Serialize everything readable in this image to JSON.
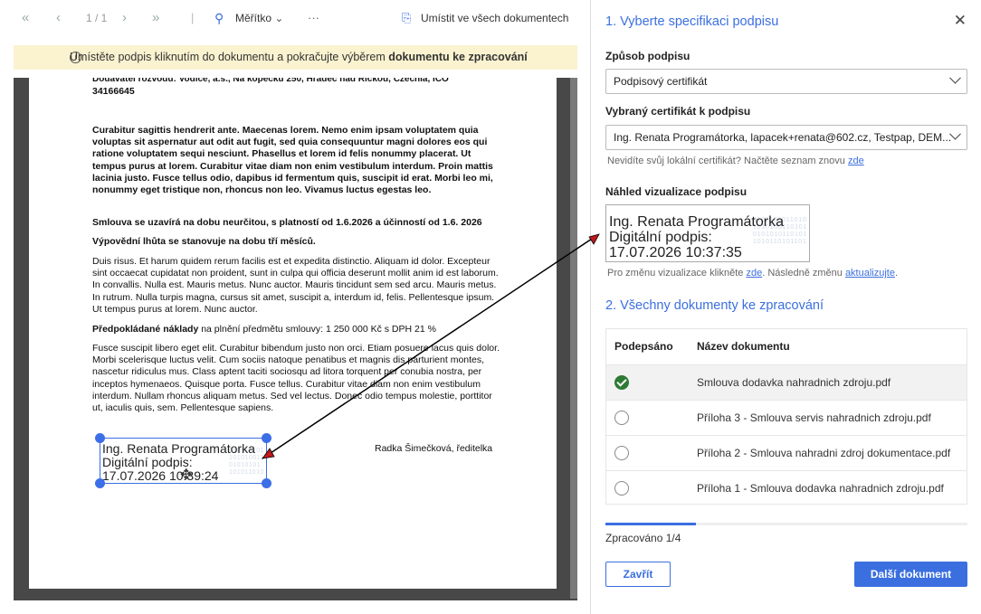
{
  "toolbar": {
    "page_indicator": "1 / 1",
    "zoom_label": "Měřítko",
    "more": "···",
    "place_all": "Umístit ve všech dokumentech"
  },
  "banner": {
    "text_main": "Umístěte podpis kliknutím do dokumentu a pokračujte výběrem ",
    "text_bold": "dokumentu ke zpracování"
  },
  "document": {
    "cut_line1": "Dodavatel rozvodu:    Vodice, a.s., Na kopečku 250, Hradec nad Rickou, Czechia, ICO",
    "cut_line2": "34166645",
    "para1": "Curabitur sagittis hendrerit ante. Maecenas lorem. Nemo enim ipsam voluptatem quia voluptas sit aspernatur aut odit aut fugit, sed quia consequuntur magni dolores eos qui ratione voluptatem sequi nesciunt. Phasellus et lorem id felis nonummy placerat. Ut tempus purus at lorem. Curabitur vitae diam non enim vestibulum interdum. Proin mattis lacinia justo. Fusce tellus odio, dapibus id fermentum quis, suscipit id erat. Morbi leo mi, nonummy eget tristique non, rhoncus non leo. Vivamus luctus egestas leo.",
    "para2": "Smlouva se uzavírá na dobu neurčitou, s platností od 1.6.2026 a účinností od 1.6. 2026",
    "para3": "Výpovědní lhůta se stanovuje na dobu tří měsíců.",
    "para4": "Duis risus. Et harum quidem rerum facilis est et expedita distinctio. Aliquam id dolor. Excepteur sint occaecat cupidatat non proident, sunt in culpa qui officia deserunt mollit anim id est laborum. In convallis. Nulla est. Mauris metus. Nunc auctor. Mauris tincidunt sem sed arcu. Mauris metus. In rutrum. Nulla turpis magna, cursus sit amet, suscipit a, interdum id, felis. Pellentesque ipsum. Ut tempus purus at lorem. Nunc auctor.",
    "para5_bold": "Předpokládané náklady",
    "para5_rest": " na plnění předmětu smlouvy: 1 250 000 Kč s DPH 21 %",
    "para6": "Fusce suscipit libero eget elit. Curabitur bibendum justo non orci. Etiam posuere lacus quis dolor. Morbi scelerisque luctus velit. Cum sociis natoque penatibus et magnis dis parturient montes, nascetur ridiculus mus. Class aptent taciti sociosqu ad litora torquent per conubia nostra, per inceptos hymenaeos. Quisque porta. Fusce tellus. Curabitur vitae diam non enim vestibulum interdum. Nullam rhoncus aliquam metus. Sed vel lectus. Donec odio tempus molestie, porttitor ut, iaculis quis, sem. Pellentesque sapiens.",
    "signer": "Radka Šimečková, ředitelka",
    "sig_name": "Ing. Renata Programátorka",
    "sig_label": "Digitální podpis:",
    "sig_date": "17.07.2026 10:39:24"
  },
  "panel": {
    "section1_title": "1. Vyberte specifikaci podpisu",
    "method_label": "Způsob podpisu",
    "method_value": "Podpisový certifikát",
    "cert_label": "Vybraný certifikát k podpisu",
    "cert_value": "Ing. Renata Programátorka, lapacek+renata@602.cz, Testpap, DEM...",
    "cert_hint": "Nevidíte svůj lokální certifikát? Načtěte seznam znovu ",
    "cert_hint_link": "zde",
    "preview_label": "Náhled vizualizace podpisu",
    "preview_name": "Ing. Renata Programátorka",
    "preview_label2": "Digitální podpis:",
    "preview_date": "17.07.2026 10:37:35",
    "preview_hint1": "Pro změnu vizualizace klikněte ",
    "preview_hint_link1": "zde",
    "preview_hint2": ". Následně změnu ",
    "preview_hint_link2": "aktualizujte",
    "preview_hint3": ".",
    "section2_title": "2. Všechny dokumenty ke zpracování",
    "col_signed": "Podepsáno",
    "col_name": "Název dokumentu",
    "documents": [
      {
        "name": "Smlouva dodavka nahradnich zdroju.pdf",
        "signed": true
      },
      {
        "name": "Příloha 3 - Smlouva servis nahradnich zdroju.pdf",
        "signed": false
      },
      {
        "name": "Příloha 2 - Smlouva nahradni zdroj dokumentace.pdf",
        "signed": false
      },
      {
        "name": "Příloha 1 - Smlouva dodavka nahradnich zdroju.pdf",
        "signed": false
      }
    ],
    "progress_fraction": 0.25,
    "progress_text": "Zpracováno 1/4",
    "close_label": "Zavřít",
    "next_label": "Další dokument"
  },
  "colors": {
    "accent": "#3b6fe0",
    "banner_bg": "#fbf3d0",
    "signed_green": "#2d7a34",
    "arrow": "#000000",
    "arrowhead": "#c0171a"
  }
}
